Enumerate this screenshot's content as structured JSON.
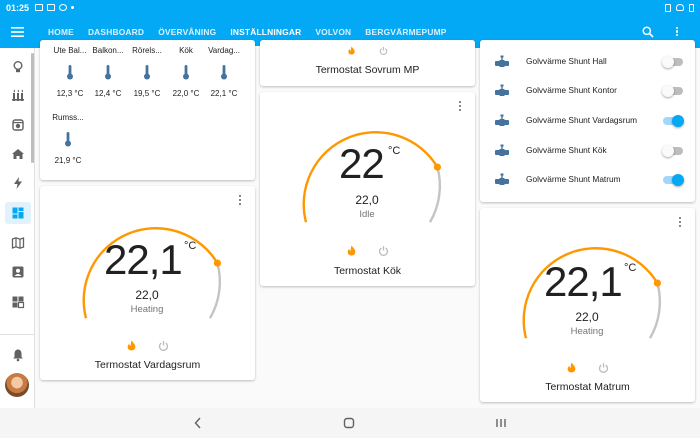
{
  "status_bar": {
    "time": "01:25"
  },
  "nav_tabs": [
    {
      "label": "HOME"
    },
    {
      "label": "DASHBOARD"
    },
    {
      "label": "ÖVERVÅNING"
    },
    {
      "label": "INSTÄLLNINGAR"
    },
    {
      "label": "VOLVON"
    },
    {
      "label": "BERGVÄRMEPUMP"
    }
  ],
  "active_tab": "INSTÄLLNINGAR",
  "sidebar_icons": [
    "lightbulb-icon",
    "radiator-icon",
    "security-camera-icon",
    "home-icon",
    "lightning-icon",
    "dashboard-icon",
    "map-icon",
    "account-box-icon",
    "view-dashboard-icon",
    "bell-icon"
  ],
  "sensors": [
    {
      "name": "Ute Bal...",
      "value": "12,3 °C"
    },
    {
      "name": "Balkon...",
      "value": "12,4 °C"
    },
    {
      "name": "Rörels...",
      "value": "19,5 °C"
    },
    {
      "name": "Kök",
      "value": "22,0 °C"
    },
    {
      "name": "Vardag...",
      "value": "22,1 °C"
    },
    {
      "name": "Rumss...",
      "value": "21,9 °C"
    }
  ],
  "thermostats": {
    "sovrum": {
      "name": "Termostat Sovrum MP"
    },
    "vardagsrum": {
      "temp": "22,1",
      "unit": "°C",
      "target": "22,0",
      "mode": "Heating",
      "name": "Termostat Vardagsrum"
    },
    "kok": {
      "temp": "22",
      "unit": "°C",
      "target": "22,0",
      "mode": "Idle",
      "name": "Termostat Kök"
    },
    "matrum": {
      "temp": "22,1",
      "unit": "°C",
      "target": "22,0",
      "mode": "Heating",
      "name": "Termostat Matrum"
    }
  },
  "switches": [
    {
      "label": "Golvvärme Shunt Hall",
      "state": "off"
    },
    {
      "label": "Golvvärme Shunt Kontor",
      "state": "off"
    },
    {
      "label": "Golvvärme Shunt Vardagsrum",
      "state": "on"
    },
    {
      "label": "Golvvärme Shunt Kök",
      "state": "off"
    },
    {
      "label": "Golvvärme Shunt Matrum",
      "state": "on"
    }
  ],
  "colors": {
    "primary": "#03a9f4",
    "heat": "#ff9800",
    "arc_track": "#c4c4c4"
  }
}
